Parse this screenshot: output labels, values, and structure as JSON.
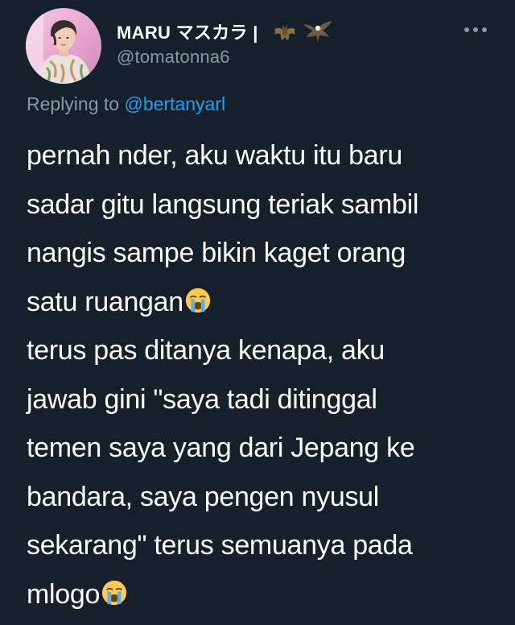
{
  "tweet": {
    "author": {
      "display_name": "MARU マスカラ |",
      "handle": "@tomatonna6",
      "badge_icons": [
        "bat-icon",
        "eagle-icon"
      ]
    },
    "more_icon": "more-dots-icon",
    "replying_prefix": "Replying to",
    "replying_mention": "@bertanyarl",
    "body_lines": [
      "pernah nder, aku waktu itu baru",
      "sadar gitu langsung teriak sambil",
      "nangis sampe bikin kaget orang",
      "satu ruangan",
      "terus pas ditanya kenapa, aku",
      "jawab gini \"saya tadi ditinggal",
      "temen saya yang dari Jepang ke",
      "bandara, saya pengen nyusul",
      "sekarang\" terus semuanya pada",
      "mlogo"
    ],
    "emoji": "loudly-crying-face-emoji"
  },
  "colors": {
    "background": "#15202b",
    "text": "#ffffff",
    "secondary": "#8899a6",
    "link": "#1da1f2"
  }
}
